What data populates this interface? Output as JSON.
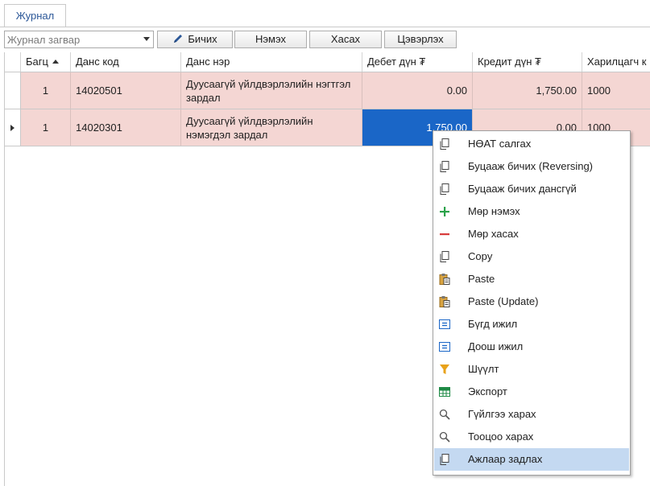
{
  "tabs": [
    {
      "label": "Журнал"
    }
  ],
  "toolbar": {
    "template_placeholder": "Журнал загвар",
    "write_label": "Бичих",
    "add_label": "Нэмэх",
    "delete_label": "Хасах",
    "refresh_label": "Цэвэрлэх"
  },
  "grid": {
    "columns": [
      "Багц",
      "Данс код",
      "Данс нэр",
      "Дебет дүн ₮",
      "Кредит дүн ₮",
      "Харилцагч к"
    ],
    "sorted_column": "Багц",
    "rows": [
      {
        "batch": "1",
        "account_code": "14020501",
        "account_name": "Дуусаагүй үйлдвэрлэлийн нэгтгэл зардал",
        "debit": "0.00",
        "credit": "1,750.00",
        "partner": "1000"
      },
      {
        "batch": "1",
        "account_code": "14020301",
        "account_name": "Дуусаагүй үйлдвэрлэлийн нэмэгдэл зардал",
        "debit": "1,750.00",
        "credit": "0.00",
        "partner": "1000"
      }
    ]
  },
  "context_menu": {
    "items": [
      {
        "label": "НӨАТ салгах",
        "icon": "copy-icon"
      },
      {
        "label": "Буцааж бичих (Reversing)",
        "icon": "copy-icon"
      },
      {
        "label": "Буцааж бичих дансгүй",
        "icon": "copy-icon"
      },
      {
        "label": "Мөр нэмэх",
        "icon": "plus-icon"
      },
      {
        "label": "Мөр хасах",
        "icon": "minus-icon"
      },
      {
        "label": "Copy",
        "icon": "copy-icon"
      },
      {
        "label": "Paste",
        "icon": "paste-icon"
      },
      {
        "label": "Paste (Update)",
        "icon": "paste-icon"
      },
      {
        "label": "Бүгд ижил",
        "icon": "equal-icon"
      },
      {
        "label": "Доош ижил",
        "icon": "equal-icon"
      },
      {
        "label": "Шүүлт",
        "icon": "filter-icon"
      },
      {
        "label": "Экспорт",
        "icon": "excel-icon"
      },
      {
        "label": "Гүйлгээ харах",
        "icon": "magnifier-icon"
      },
      {
        "label": "Тооцоо харах",
        "icon": "magnifier-icon"
      },
      {
        "label": "Ажлаар задлах",
        "icon": "copy-icon"
      }
    ],
    "highlighted_index": 14
  },
  "colors": {
    "row_background": "#f4d6d3",
    "selected_cell": "#1a66c7",
    "menu_highlight": "#c4d9f1",
    "tab_text": "#2b5797"
  }
}
